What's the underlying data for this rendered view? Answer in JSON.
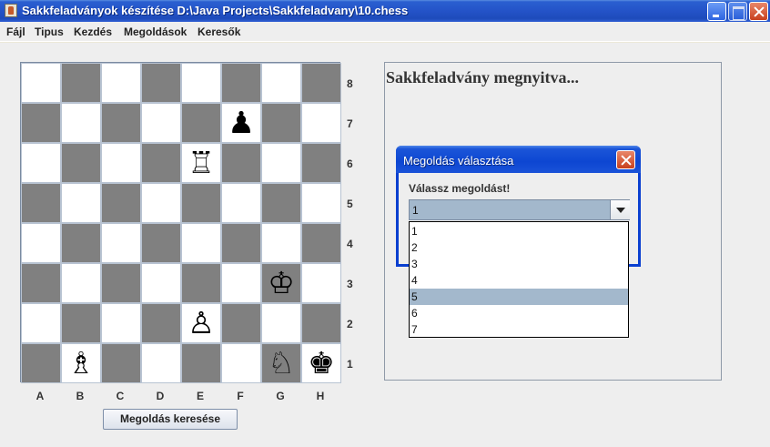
{
  "window": {
    "title": "Sakkfeladványok készítése D:\\Java Projects\\Sakkfeladvany\\10.chess"
  },
  "menu": [
    "Fájl",
    "Tipus",
    "Kezdés",
    "Megoldások",
    "Keresők"
  ],
  "board": {
    "files": [
      "A",
      "B",
      "C",
      "D",
      "E",
      "F",
      "G",
      "H"
    ],
    "ranks": [
      "8",
      "7",
      "6",
      "5",
      "4",
      "3",
      "2",
      "1"
    ],
    "pieces": {
      "f7": {
        "glyph": "♟",
        "name": "black-pawn"
      },
      "e6": {
        "glyph": "♖",
        "name": "white-rook"
      },
      "g3": {
        "glyph": "♔",
        "name": "white-king"
      },
      "e2": {
        "glyph": "♙",
        "name": "white-pawn"
      },
      "b1": {
        "glyph": "♗",
        "name": "white-bishop"
      },
      "g1": {
        "glyph": "♘",
        "name": "white-knight"
      },
      "h1": {
        "glyph": "♚",
        "name": "black-king"
      }
    }
  },
  "solve_button": "Megoldás keresése",
  "panel_message": "Sakkfeladvány megnyitva...",
  "dialog": {
    "title": "Megoldás választása",
    "prompt": "Válassz megoldást!",
    "selected_value": "1",
    "options": [
      "1",
      "2",
      "3",
      "4",
      "5",
      "6",
      "7"
    ],
    "highlighted_option": "5"
  },
  "colors": {
    "dark_square": "#808080",
    "light_square": "#ffffff",
    "selection": "#a3b8cc",
    "title_blue": "#0d46d2"
  }
}
